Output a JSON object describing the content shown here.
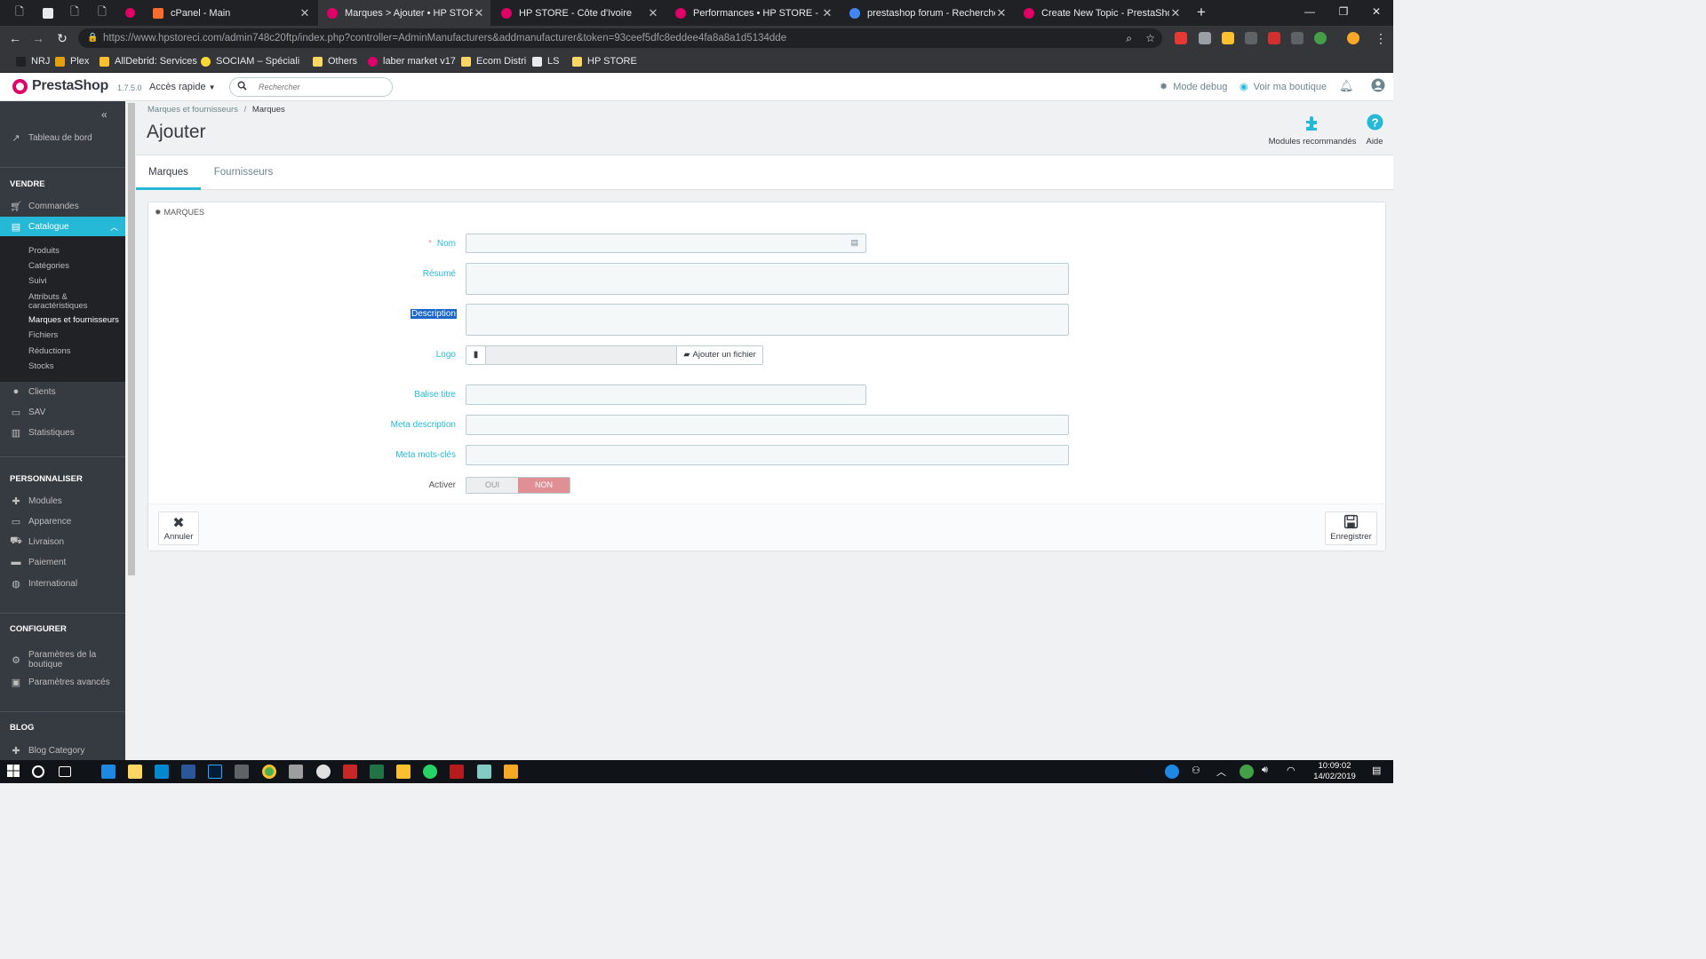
{
  "browser": {
    "tabs": [
      {
        "title": "cPanel - Main",
        "fav": "#ff6c2c"
      },
      {
        "title": "Marques > Ajouter • HP STORE -",
        "fav": "#df0067",
        "active": true
      },
      {
        "title": "HP STORE - Côte d'Ivoire",
        "fav": "#df0067"
      },
      {
        "title": "Performances • HP STORE - Côte",
        "fav": "#df0067"
      },
      {
        "title": "prestashop forum - Recherche G",
        "fav": "#4285f4"
      },
      {
        "title": "Create New Topic - PrestaShop",
        "fav": "#df0067"
      }
    ],
    "url": "https://www.hpstoreci.com/admin748c20ftp/index.php?controller=AdminManufacturers&addmanufacturer&token=93ceef5dfc8eddee4fa8a8a1d5134dde",
    "bookmarks": [
      "NRJ",
      "Plex",
      "AllDebrid: Services",
      "SOCIAM – Spécialiste",
      "Others",
      "laber market v17",
      "Ecom Distri",
      "LS",
      "HP STORE"
    ]
  },
  "header": {
    "brand": "PrestaShop",
    "version": "1.7.5.0",
    "quick_access": "Accès rapide",
    "search_placeholder": "Rechercher",
    "debug": "Mode debug",
    "view_shop": "Voir ma boutique"
  },
  "sidebar": {
    "dashboard": "Tableau de bord",
    "sections": {
      "sell": "VENDRE",
      "customize": "PERSONNALISER",
      "configure": "CONFIGURER",
      "blog": "BLOG"
    },
    "sell_items": [
      "Commandes",
      "Catalogue",
      "Clients",
      "SAV",
      "Statistiques"
    ],
    "catalog_sub": [
      "Produits",
      "Catégories",
      "Suivi",
      "Attributs & caractéristiques",
      "Marques et fournisseurs",
      "Fichiers",
      "Réductions",
      "Stocks"
    ],
    "customize_items": [
      "Modules",
      "Apparence",
      "Livraison",
      "Paiement",
      "International"
    ],
    "configure_items": [
      "Paramètres de la boutique",
      "Paramètres avancés"
    ],
    "blog_items": [
      "Blog Category"
    ]
  },
  "page": {
    "breadcrumb_parent": "Marques et fournisseurs",
    "breadcrumb_current": "Marques",
    "title": "Ajouter",
    "toolbar": {
      "modules": "Modules recommandés",
      "help": "Aide"
    },
    "tabs": [
      "Marques",
      "Fournisseurs"
    ]
  },
  "form": {
    "panel_title": "MARQUES",
    "labels": {
      "name": "Nom",
      "summary": "Résumé",
      "description": "Description",
      "logo": "Logo",
      "meta_title": "Balise titre",
      "meta_description": "Meta description",
      "meta_keywords": "Meta mots-clés",
      "active": "Activer"
    },
    "values": {
      "name": "",
      "summary": "",
      "description": "",
      "meta_title": "",
      "meta_description": "",
      "meta_keywords": ""
    },
    "file_button": "Ajouter un fichier",
    "toggle": {
      "yes": "OUI",
      "no": "NON",
      "selected": "NON"
    },
    "cancel": "Annuler",
    "save": "Enregistrer"
  },
  "taskbar": {
    "time": "10:09:02",
    "date": "14/02/2019"
  },
  "colors": {
    "accent": "#25b9d7",
    "sidebar": "#363a41",
    "brand": "#df0067",
    "toggle_no": "#e08f95"
  }
}
